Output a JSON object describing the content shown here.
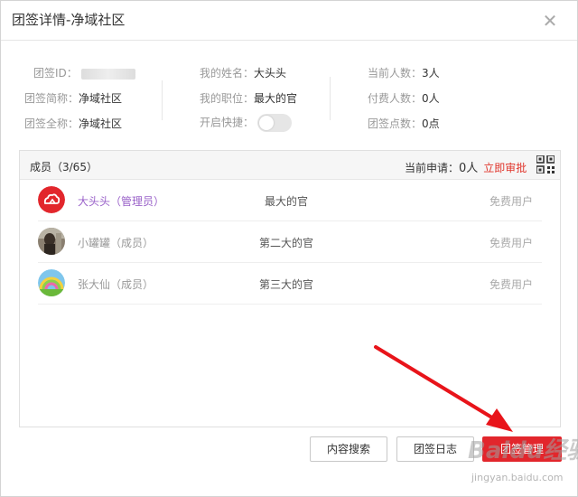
{
  "dialog": {
    "title": "团签详情-净域社区",
    "close_glyph": "✕"
  },
  "info": {
    "id_label": "团签ID：",
    "short_label": "团签简称：",
    "short_value": "净域社区",
    "full_label": "团签全称：",
    "full_value": "净域社区",
    "name_label": "我的姓名：",
    "name_value": "大头头",
    "position_label": "我的职位：",
    "position_value": "最大的官",
    "quick_label": "开启快捷：",
    "quick_enabled": false,
    "current_label": "当前人数：",
    "current_value": "3人",
    "paid_label": "付费人数：",
    "paid_value": "0人",
    "points_label": "团签点数：",
    "points_value": "0点"
  },
  "members": {
    "header_left": "成员（3/65）",
    "apply_label": "当前申请：",
    "apply_count": "0人",
    "approve_link": "立即审批",
    "qr_icon": "qr-code-icon",
    "items": [
      {
        "name": "大头头（管理员）",
        "role": "最大的官",
        "type": "免费用户",
        "name_color": "#9a62c9",
        "avatar_icon": "cloud-logo-icon"
      },
      {
        "name": "小罐罐（成员）",
        "role": "第二大的官",
        "type": "免费用户",
        "name_color": "#999999",
        "avatar_icon": "photo-avatar-icon"
      },
      {
        "name": "张大仙（成员）",
        "role": "第三大的官",
        "type": "免费用户",
        "name_color": "#999999",
        "avatar_icon": "rainbow-avatar-icon"
      }
    ]
  },
  "buttons": {
    "search": "内容搜索",
    "log": "团签日志",
    "manage": "团签管理"
  },
  "colors": {
    "accent": "#e2262c",
    "admin_name": "#9a62c9",
    "approve_link": "#e0342a"
  },
  "watermark": {
    "main": "Baidu经验",
    "sub": "jingyan.baidu.com"
  }
}
